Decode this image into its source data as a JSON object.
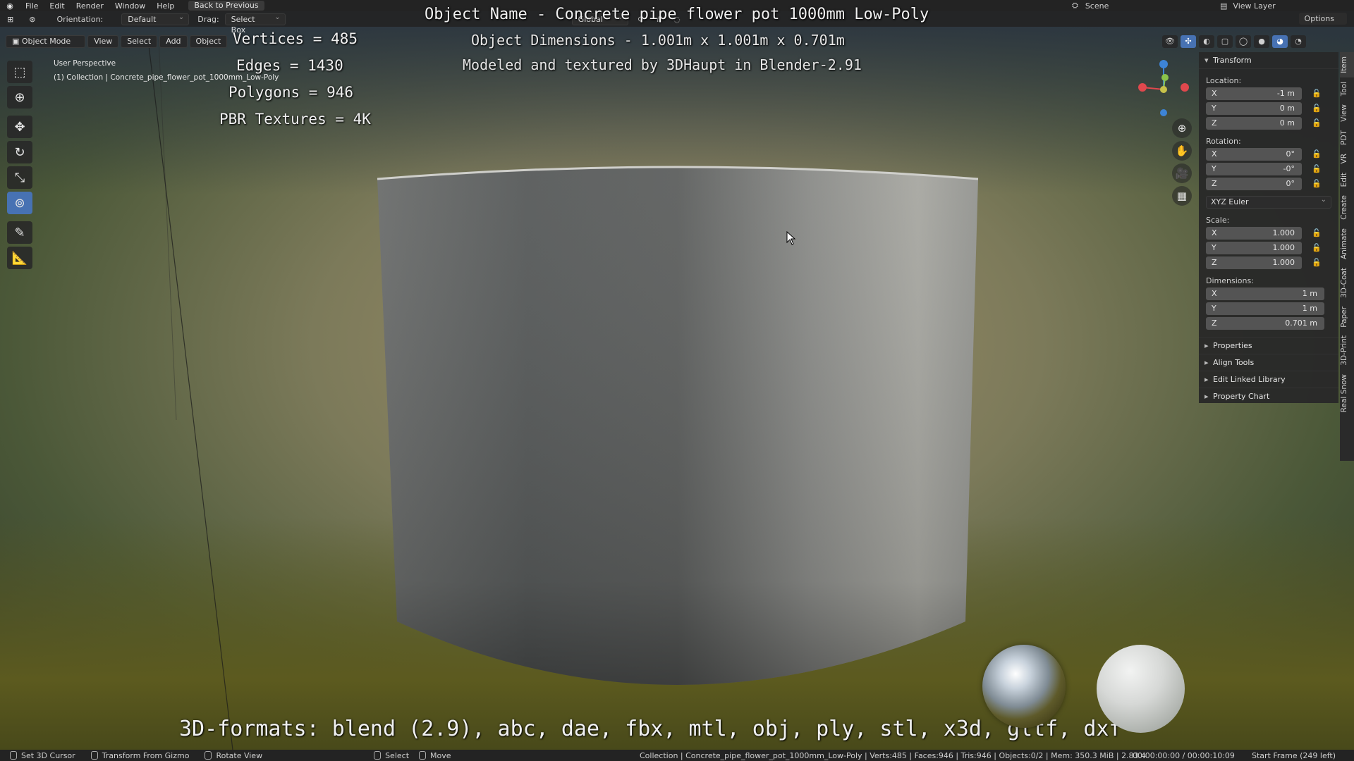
{
  "menubar": {
    "items": [
      "File",
      "Edit",
      "Render",
      "Window",
      "Help"
    ],
    "back_label": "Back to Previous",
    "scene_label": "Scene",
    "view_layer_label": "View Layer"
  },
  "toolbar": {
    "orientation_label": "Orientation:",
    "orientation_value": "Default",
    "drag_label": "Drag:",
    "drag_value": "Select Box",
    "global_label": "Global",
    "options_label": "Options"
  },
  "mode_header": {
    "mode": "Object Mode",
    "menus": [
      "View",
      "Select",
      "Add",
      "Object"
    ]
  },
  "viewport": {
    "perspective": "User Perspective",
    "collection_line": "(1) Collection | Concrete_pipe_flower_pot_1000mm_Low-Poly"
  },
  "overlay": {
    "title": "Object Name - Concrete pipe flower pot 1000mm Low-Poly",
    "dimensions": "Object Dimensions -  1.001m x 1.001m x 0.701m",
    "credit": "Modeled and textured by 3DHaupt in Blender-2.91",
    "vertices": "Vertices = 485",
    "edges": "Edges = 1430",
    "polygons": "Polygons = 946",
    "pbr": "PBR Textures = 4K",
    "formats": "3D-formats: blend (2.9), abc, dae, fbx, mtl, obj, ply, stl, x3d, gltf, dxf"
  },
  "npanel": {
    "transform_header": "Transform",
    "location_label": "Location:",
    "location": [
      {
        "axis": "X",
        "value": "-1 m"
      },
      {
        "axis": "Y",
        "value": "0 m"
      },
      {
        "axis": "Z",
        "value": "0 m"
      }
    ],
    "rotation_label": "Rotation:",
    "rotation": [
      {
        "axis": "X",
        "value": "0°"
      },
      {
        "axis": "Y",
        "value": "-0°"
      },
      {
        "axis": "Z",
        "value": "0°"
      }
    ],
    "rotation_mode": "XYZ Euler",
    "scale_label": "Scale:",
    "scale": [
      {
        "axis": "X",
        "value": "1.000"
      },
      {
        "axis": "Y",
        "value": "1.000"
      },
      {
        "axis": "Z",
        "value": "1.000"
      }
    ],
    "dimensions_label": "Dimensions:",
    "dimensions": [
      {
        "axis": "X",
        "value": "1 m"
      },
      {
        "axis": "Y",
        "value": "1 m"
      },
      {
        "axis": "Z",
        "value": "0.701 m"
      }
    ],
    "subpanels": [
      "Properties",
      "Align Tools",
      "Edit Linked Library",
      "Property Chart"
    ]
  },
  "vertical_tabs": [
    "Item",
    "Tool",
    "View",
    "PDT",
    "VR",
    "Edit",
    "Create",
    "Animate",
    "3D-Coat",
    "Paper",
    "3D-Print",
    "Real Snow"
  ],
  "statusbar": {
    "items": [
      "Set 3D Cursor",
      "Transform From Gizmo",
      "Rotate View",
      "Select",
      "Move"
    ],
    "info": "Collection | Concrete_pipe_flower_pot_1000mm_Low-Poly | Verts:485 | Faces:946 | Tris:946 | Objects:0/2 | Mem: 350.3 MiB | 2.83.4",
    "time": "00:00:00:00 / 00:00:10:09",
    "frame": "Start Frame (249 left)"
  },
  "colors": {
    "accent": "#4772b3",
    "axis_x": "#e0484d",
    "axis_y": "#8bc34a",
    "axis_z": "#3d84d6"
  }
}
